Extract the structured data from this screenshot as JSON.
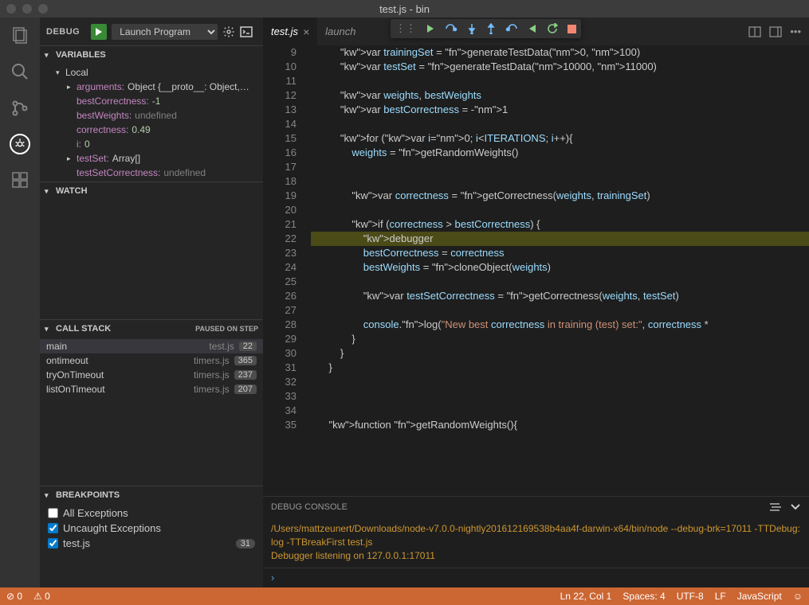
{
  "window": {
    "title": "test.js - bin"
  },
  "debugHeader": {
    "label": "DEBUG",
    "config": "Launch Program"
  },
  "sections": {
    "variables": {
      "title": "VARIABLES",
      "scope": "Local",
      "vars": [
        {
          "name": "arguments:",
          "val": "Object {__proto__: Object,…",
          "caret": "▸"
        },
        {
          "name": "bestCorrectness:",
          "val": "-1",
          "cls": "num"
        },
        {
          "name": "bestWeights:",
          "val": "undefined",
          "cls": "undef"
        },
        {
          "name": "correctness:",
          "val": "0.49",
          "cls": "num"
        },
        {
          "name": "i:",
          "val": "0",
          "cls": "num"
        },
        {
          "name": "testSet:",
          "val": "Array[]",
          "caret": "▸"
        },
        {
          "name": "testSetCorrectness:",
          "val": "undefined",
          "cls": "undef"
        }
      ]
    },
    "watch": {
      "title": "WATCH"
    },
    "callstack": {
      "title": "CALL STACK",
      "badge": "PAUSED ON STEP",
      "frames": [
        {
          "fn": "main",
          "file": "test.js",
          "line": "22",
          "active": true
        },
        {
          "fn": "ontimeout",
          "file": "timers.js",
          "line": "365"
        },
        {
          "fn": "tryOnTimeout",
          "file": "timers.js",
          "line": "237"
        },
        {
          "fn": "listOnTimeout",
          "file": "timers.js",
          "line": "207"
        }
      ]
    },
    "breakpoints": {
      "title": "BREAKPOINTS",
      "items": [
        {
          "label": "All Exceptions",
          "checked": false
        },
        {
          "label": "Uncaught Exceptions",
          "checked": true
        },
        {
          "label": "test.js",
          "checked": true,
          "count": "31"
        }
      ]
    }
  },
  "tabs": {
    "active": "test.js",
    "others": [
      "launch"
    ]
  },
  "code": {
    "start": 9,
    "highlight": 22,
    "lines": [
      "        var trainingSet = generateTestData(0, 100)",
      "        var testSet = generateTestData(10000, 11000)",
      "",
      "        var weights, bestWeights",
      "        var bestCorrectness = -1",
      "",
      "        for (var i=0; i<ITERATIONS; i++){",
      "            weights = getRandomWeights()",
      "",
      "",
      "            var correctness = getCorrectness(weights, trainingSet)",
      "",
      "            if (correctness > bestCorrectness) {",
      "                debugger",
      "                bestCorrectness = correctness",
      "                bestWeights = cloneObject(weights)",
      "",
      "                var testSetCorrectness = getCorrectness(weights, testSet)",
      "",
      "                console.log(\"New best correctness in training (test) set:\", correctness *",
      "            }",
      "        }",
      "    }",
      "",
      "",
      "",
      "    function getRandomWeights(){"
    ],
    "marks": {
      "22": "yellow",
      "31": "red"
    }
  },
  "console": {
    "title": "DEBUG CONSOLE",
    "lines": [
      "/Users/mattzeunert/Downloads/node-v7.0.0-nightly201612169538b4aa4f-darwin-x64/bin/node --debug-brk=17011 -TTDebug:log -TTBreakFirst test.js",
      "Debugger listening on 127.0.0.1:17011"
    ],
    "prompt": "›"
  },
  "status": {
    "errors": "0",
    "warnings": "0",
    "pos": "Ln 22, Col 1",
    "spaces": "Spaces: 4",
    "enc": "UTF-8",
    "eol": "LF",
    "lang": "JavaScript"
  }
}
